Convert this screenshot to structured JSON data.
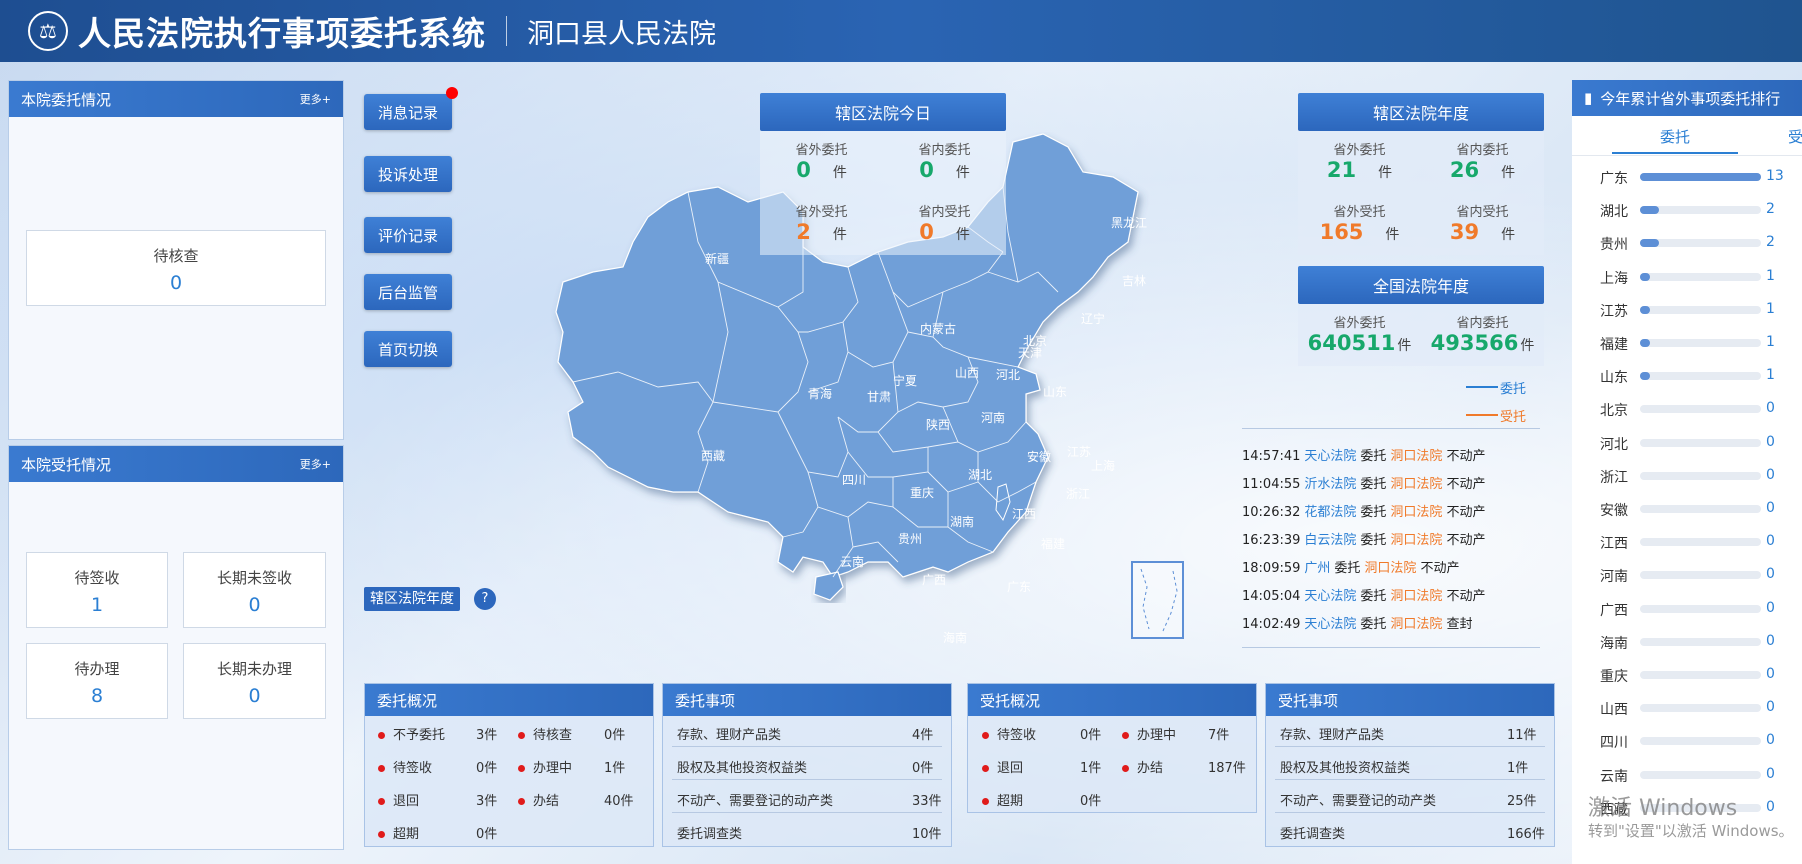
{
  "header": {
    "system_title": "人民法院执行事项委托系统",
    "court_name": "洞口县人民法院"
  },
  "left_top": {
    "title": "本院委托情况",
    "more": "更多+",
    "stats": [
      {
        "label": "待核查",
        "value": "0"
      }
    ]
  },
  "left_bottom": {
    "title": "本院受托情况",
    "more": "更多+",
    "stats": [
      {
        "label": "待签收",
        "value": "1"
      },
      {
        "label": "长期未签收",
        "value": "0"
      },
      {
        "label": "待办理",
        "value": "8"
      },
      {
        "label": "长期未办理",
        "value": "0"
      }
    ]
  },
  "side_buttons": [
    "消息记录",
    "投诉处理",
    "评价记录",
    "后台监管",
    "首页切换"
  ],
  "year_toggle": {
    "label": "辖区法院年度",
    "help": "?"
  },
  "today": {
    "title": "辖区法院今日",
    "items": [
      {
        "label": "省外委托",
        "value": "0",
        "unit": "件"
      },
      {
        "label": "省内委托",
        "value": "0",
        "unit": "件"
      },
      {
        "label": "省外受托",
        "value": "2",
        "unit": "件"
      },
      {
        "label": "省内受托",
        "value": "0",
        "unit": "件"
      }
    ]
  },
  "year": {
    "title": "辖区法院年度",
    "items": [
      {
        "label": "省外委托",
        "value": "21",
        "unit": "件"
      },
      {
        "label": "省内委托",
        "value": "26",
        "unit": "件"
      },
      {
        "label": "省外受托",
        "value": "165",
        "unit": "件"
      },
      {
        "label": "省内受托",
        "value": "39",
        "unit": "件"
      }
    ]
  },
  "national": {
    "title": "全国法院年度",
    "items": [
      {
        "label": "省外委托",
        "value": "640511",
        "unit": "件"
      },
      {
        "label": "省内委托",
        "value": "493566",
        "unit": "件"
      }
    ]
  },
  "legend": {
    "items": [
      {
        "label": "委托",
        "color": "#2b7fd3"
      },
      {
        "label": "受托",
        "color": "#f07a2a"
      }
    ]
  },
  "map_labels": [
    "新疆",
    "西藏",
    "青海",
    "甘肃",
    "内蒙古",
    "宁夏",
    "陕西",
    "山西",
    "河北",
    "北京",
    "天津",
    "山东",
    "河南",
    "四川",
    "重庆",
    "湖北",
    "安徽",
    "江苏",
    "上海",
    "浙江",
    "江西",
    "湖南",
    "贵州",
    "云南",
    "广西",
    "广东",
    "福建",
    "海南",
    "辽宁",
    "吉林",
    "黑龙江"
  ],
  "logs": [
    {
      "time": "14:57:41",
      "from": "天心法院",
      "verb": "委托",
      "to": "洞口法院",
      "type": "不动产"
    },
    {
      "time": "11:04:55",
      "from": "沂水法院",
      "verb": "委托",
      "to": "洞口法院",
      "type": "不动产"
    },
    {
      "time": "10:26:32",
      "from": "花都法院",
      "verb": "委托",
      "to": "洞口法院",
      "type": "不动产"
    },
    {
      "time": "16:23:39",
      "from": "白云法院",
      "verb": "委托",
      "to": "洞口法院",
      "type": "不动产"
    },
    {
      "time": "18:09:59",
      "from": "广州",
      "verb": "委托",
      "to": "洞口法院",
      "type": "不动产"
    },
    {
      "time": "14:05:04",
      "from": "天心法院",
      "verb": "委托",
      "to": "洞口法院",
      "type": "不动产"
    },
    {
      "time": "14:02:49",
      "from": "天心法院",
      "verb": "委托",
      "to": "洞口法院",
      "type": "查封"
    }
  ],
  "weituo_overview": {
    "title": "委托概况",
    "items": [
      {
        "label": "不予委托",
        "value": "3件"
      },
      {
        "label": "待核查",
        "value": "0件"
      },
      {
        "label": "待签收",
        "value": "0件"
      },
      {
        "label": "办理中",
        "value": "1件"
      },
      {
        "label": "退回",
        "value": "3件"
      },
      {
        "label": "办结",
        "value": "40件"
      },
      {
        "label": "超期",
        "value": "0件"
      }
    ]
  },
  "weituo_items": {
    "title": "委托事项",
    "items": [
      {
        "label": "存款、理财产品类",
        "value": "4件"
      },
      {
        "label": "股权及其他投资权益类",
        "value": "0件"
      },
      {
        "label": "不动产、需要登记的动产类",
        "value": "33件"
      },
      {
        "label": "委托调查类",
        "value": "10件"
      }
    ]
  },
  "shoutuo_overview": {
    "title": "受托概况",
    "items": [
      {
        "label": "待签收",
        "value": "0件"
      },
      {
        "label": "办理中",
        "value": "7件"
      },
      {
        "label": "退回",
        "value": "1件"
      },
      {
        "label": "办结",
        "value": "187件"
      },
      {
        "label": "超期",
        "value": "0件"
      }
    ]
  },
  "shoutuo_items": {
    "title": "受托事项",
    "items": [
      {
        "label": "存款、理财产品类",
        "value": "11件"
      },
      {
        "label": "股权及其他投资权益类",
        "value": "1件"
      },
      {
        "label": "不动产、需要登记的动产类",
        "value": "25件"
      },
      {
        "label": "委托调查类",
        "value": "166件"
      }
    ]
  },
  "ranking": {
    "title": "今年累计省外事项委托排行",
    "tabs": [
      "委托",
      "受"
    ],
    "max": 13,
    "rows": [
      {
        "name": "广东",
        "value": 13
      },
      {
        "name": "湖北",
        "value": 2
      },
      {
        "name": "贵州",
        "value": 2
      },
      {
        "name": "上海",
        "value": 1
      },
      {
        "name": "江苏",
        "value": 1
      },
      {
        "name": "福建",
        "value": 1
      },
      {
        "name": "山东",
        "value": 1
      },
      {
        "name": "北京",
        "value": 0
      },
      {
        "name": "河北",
        "value": 0
      },
      {
        "name": "浙江",
        "value": 0
      },
      {
        "name": "安徽",
        "value": 0
      },
      {
        "name": "江西",
        "value": 0
      },
      {
        "name": "河南",
        "value": 0
      },
      {
        "name": "广西",
        "value": 0
      },
      {
        "name": "海南",
        "value": 0
      },
      {
        "name": "重庆",
        "value": 0
      },
      {
        "name": "山西",
        "value": 0
      },
      {
        "name": "四川",
        "value": 0
      },
      {
        "name": "云南",
        "value": 0
      },
      {
        "name": "西藏",
        "value": 0
      }
    ]
  },
  "watermark": {
    "line1": "激活 Windows",
    "line2": "转到\"设置\"以激活 Windows。"
  }
}
